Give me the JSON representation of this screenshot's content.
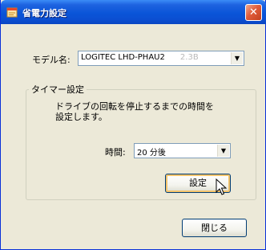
{
  "window": {
    "title": "省電力設定",
    "close_glyph": "✕",
    "app_icon": "document-icon"
  },
  "model": {
    "label": "モデル名:",
    "value": "LOGITEC LHD-PHAU2",
    "value_dim": "2.3B"
  },
  "timer_group": {
    "title": "タイマー設定",
    "description": "ドライブの回転を停止するまでの時間を\n設定します。",
    "time_label": "時間:",
    "time_value": "20 分後",
    "set_button": "設定"
  },
  "close_button": "閉じる",
  "colors": {
    "title_bar": "#0a55d8",
    "window_bg": "#ece9d8",
    "close_red": "#e15c3a",
    "focus_ring": "#f3c36b"
  }
}
